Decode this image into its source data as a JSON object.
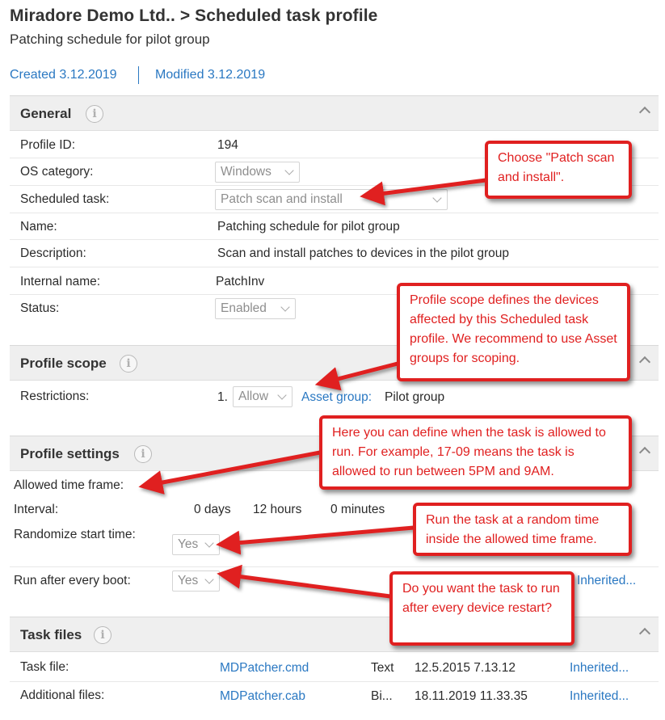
{
  "header": {
    "title": "Miradore Demo Ltd.. > Scheduled task profile",
    "subtitle": "Patching schedule for pilot group",
    "created": "Created 3.12.2019",
    "modified": "Modified 3.12.2019"
  },
  "icons": {
    "info": "info-icon",
    "collapse": "chevron-up-icon",
    "dropdown": "chevron-down-icon"
  },
  "general": {
    "title": "General",
    "info_glyph": "i",
    "profile_id_label": "Profile ID:",
    "profile_id_value": "194",
    "os_category_label": "OS category:",
    "os_category_value": "Windows",
    "scheduled_task_label": "Scheduled task:",
    "scheduled_task_value": "Patch scan and install",
    "name_label": "Name:",
    "name_value": "Patching schedule for pilot group",
    "description_label": "Description:",
    "description_value": "Scan and install patches to devices in the pilot group",
    "internal_name_label": "Internal name:",
    "internal_name_value": "PatchInv",
    "status_label": "Status:",
    "status_value": "Enabled"
  },
  "scope": {
    "title": "Profile scope",
    "info_glyph": "i",
    "restrictions_label": "Restrictions:",
    "restriction_index": "1.",
    "restriction_mode": "Allow",
    "asset_group_link": "Asset group:",
    "asset_group_value": "Pilot group"
  },
  "settings": {
    "title": "Profile settings",
    "info_glyph": "i",
    "time_frame_label": "Allowed time frame:",
    "interval_label": "Interval:",
    "interval_days": "0 days",
    "interval_hours": "12 hours",
    "interval_minutes": "0 minutes",
    "randomize_label": "Randomize start time:",
    "randomize_value": "Yes",
    "run_after_boot_label": "Run after every boot:",
    "run_after_boot_value": "Yes",
    "run_after_boot_inherited": "Inherited..."
  },
  "task_files": {
    "title": "Task files",
    "info_glyph": "i",
    "rows": [
      {
        "label": "Task file:",
        "file": "MDPatcher.cmd",
        "type": "Text",
        "date": "12.5.2015 7.13.12",
        "inherited": "Inherited..."
      },
      {
        "label": "Additional files:",
        "file": "MDPatcher.cab",
        "type": "Bi...",
        "date": "18.11.2019 11.33.35",
        "inherited": "Inherited..."
      }
    ]
  },
  "callouts": {
    "patch": "Choose \"Patch scan and install\".",
    "scope": "Profile scope defines the devices affected by this Scheduled task profile. We recommend to use Asset groups for scoping.",
    "timeframe": "Here you can define when the task is allowed to run. For example, 17-09 means the task is allowed to run between 5PM and 9AM.",
    "random": "Run the task at a random time inside the allowed time frame.",
    "boot": "Do you want the task to run after every device restart?"
  },
  "colors": {
    "accent_link": "#2a78c2",
    "callout_red": "#e02020",
    "section_bg": "#efefef"
  }
}
